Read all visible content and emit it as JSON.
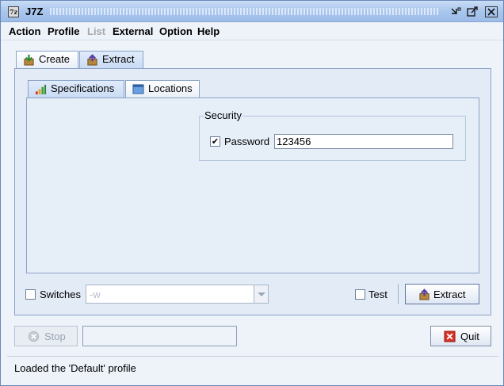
{
  "window": {
    "title": "J7Z",
    "app_icon": "7z"
  },
  "menu": [
    {
      "label": "Action",
      "enabled": true
    },
    {
      "label": "Profile",
      "enabled": true
    },
    {
      "label": "List",
      "enabled": false
    },
    {
      "label": "External",
      "enabled": true
    },
    {
      "label": "Option",
      "enabled": true
    },
    {
      "label": "Help",
      "enabled": true
    }
  ],
  "main_tabs": [
    {
      "label": "Create",
      "icon": "create-icon",
      "selected": false
    },
    {
      "label": "Extract",
      "icon": "extract-icon",
      "selected": true
    }
  ],
  "sub_tabs": [
    {
      "label": "Specifications",
      "icon": "specifications-icon",
      "selected": true
    },
    {
      "label": "Locations",
      "icon": "locations-icon",
      "selected": false
    }
  ],
  "security": {
    "title": "Security",
    "password_label": "Password",
    "password_checked": true,
    "password_value": "123456"
  },
  "options_row": {
    "switches_label": "Switches",
    "switches_checked": false,
    "switches_value": "-w",
    "test_label": "Test",
    "test_checked": false,
    "extract_button": "Extract"
  },
  "bottom_row": {
    "stop_button": "Stop",
    "progress_text": "",
    "quit_button": "Quit"
  },
  "status": {
    "message": "Loaded the 'Default' profile"
  },
  "colors": {
    "window_bg": "#eef3fa",
    "panel_bg": "#e2ebf6",
    "border": "#8ba3c7",
    "quit_icon": "#d93025"
  }
}
